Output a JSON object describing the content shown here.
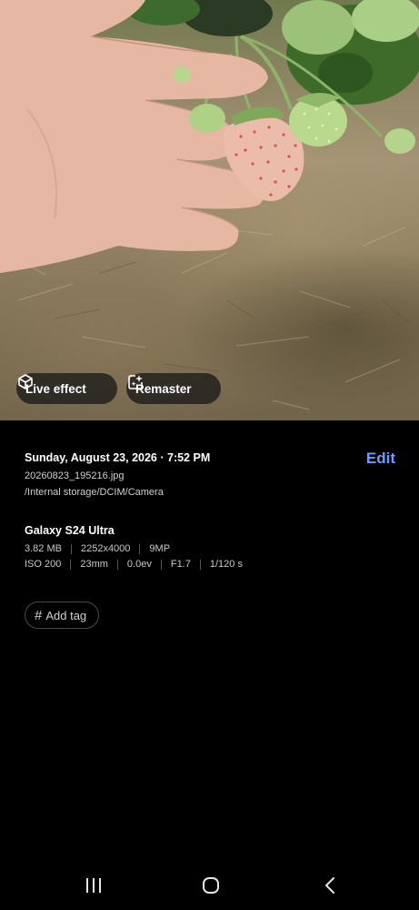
{
  "photo": {
    "subject": "hand holding pale strawberries",
    "chips": {
      "live_effect": {
        "label": "Live effect",
        "icon": "live-effect-icon"
      },
      "remaster": {
        "label": "Remaster",
        "icon": "remaster-icon"
      }
    }
  },
  "details": {
    "datetime": "Sunday, August 23, 2026 · 7:52 PM",
    "edit_label": "Edit",
    "filename": "20260823_195216.jpg",
    "path": "/Internal storage/DCIM/Camera",
    "device": "Galaxy S24 Ultra",
    "specs_row1": [
      "3.82 MB",
      "2252x4000",
      "9MP"
    ],
    "specs_row2": [
      "ISO 200",
      "23mm",
      "0.0ev",
      "F1.7",
      "1/120 s"
    ],
    "add_tag_label": "Add tag"
  },
  "navbar": {
    "recents": "recents-icon",
    "home": "home-icon",
    "back": "back-icon"
  },
  "colors": {
    "accent": "#6f9dff",
    "background": "#000000",
    "chip_bg": "#191919"
  }
}
